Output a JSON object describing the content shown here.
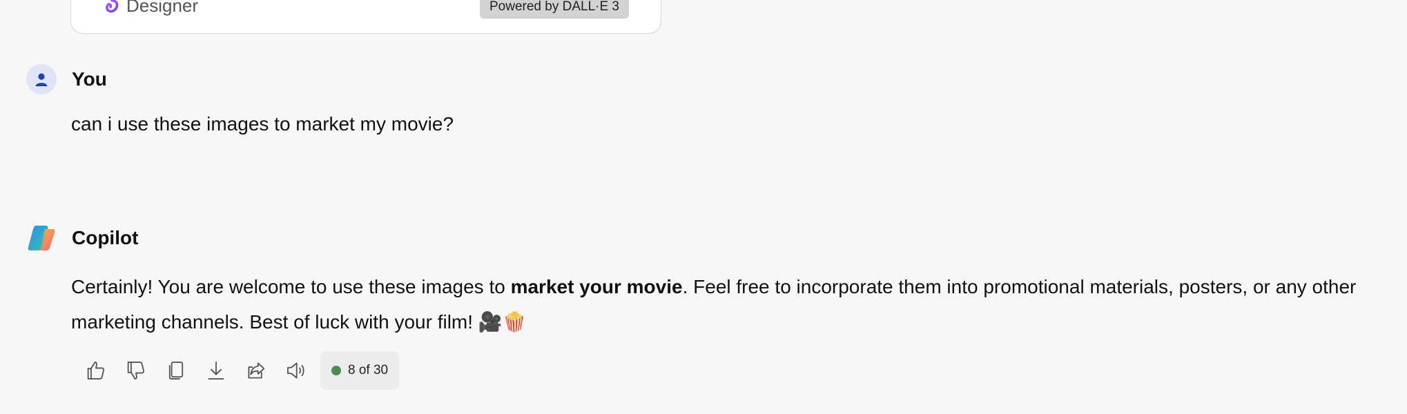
{
  "image_card": {
    "designer_label": "Designer",
    "powered_label": "Powered by DALL·E 3"
  },
  "user_message": {
    "sender": "You",
    "text": "can i use these images to market my movie?"
  },
  "assistant_message": {
    "sender": "Copilot",
    "text_before": "Certainly! You are welcome to use these images to ",
    "text_bold": "market your movie",
    "text_after": ". Feel free to incorporate them into promotional materials, posters, or any other marketing channels. Best of luck with your film! 🎥🍿"
  },
  "actions": {
    "icons": [
      "thumbs-up-icon",
      "thumbs-down-icon",
      "copy-icon",
      "download-icon",
      "share-icon",
      "read-aloud-icon"
    ],
    "counter_label": "8 of 30",
    "counter_color": "#4e8a57"
  }
}
